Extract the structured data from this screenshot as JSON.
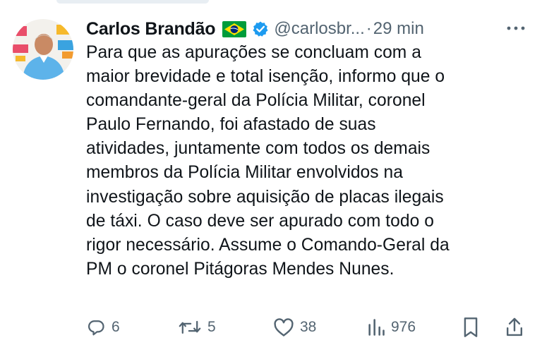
{
  "tweet": {
    "author_name": "Carlos Brandão",
    "handle": "@carlosbr...",
    "separator": "·",
    "time": "29 min",
    "text": "Para que as apurações se concluam com a\nmaior brevidade e total isenção, informo que o\ncomandante-geral da Polícia Militar, coronel\nPaulo Fernando, foi afastado de suas\natividades, juntamente com todos os demais\nmembros da Polícia Militar envolvidos na\ninvestigação sobre aquisição de placas ilegais\nde táxi. O caso deve ser apurado com todo o\nrigor necessário. Assume o Comando-Geral da\nPM o coronel Pitágoras Mendes Nunes."
  },
  "actions": {
    "replies": "6",
    "retweets": "5",
    "likes": "38",
    "views": "976"
  },
  "icons": {
    "flag": "brazil-flag-icon",
    "verified": "verified-badge-icon",
    "more": "more-options-icon",
    "reply": "reply-icon",
    "retweet": "retweet-icon",
    "like": "heart-icon",
    "views": "views-chart-icon",
    "bookmark": "bookmark-icon",
    "share": "share-icon"
  },
  "colors": {
    "text": "#0f1419",
    "secondary": "#536471",
    "verified": "#1d9bf0",
    "flag_green": "#009c3b",
    "flag_yellow": "#ffdf00",
    "flag_blue": "#002776"
  }
}
